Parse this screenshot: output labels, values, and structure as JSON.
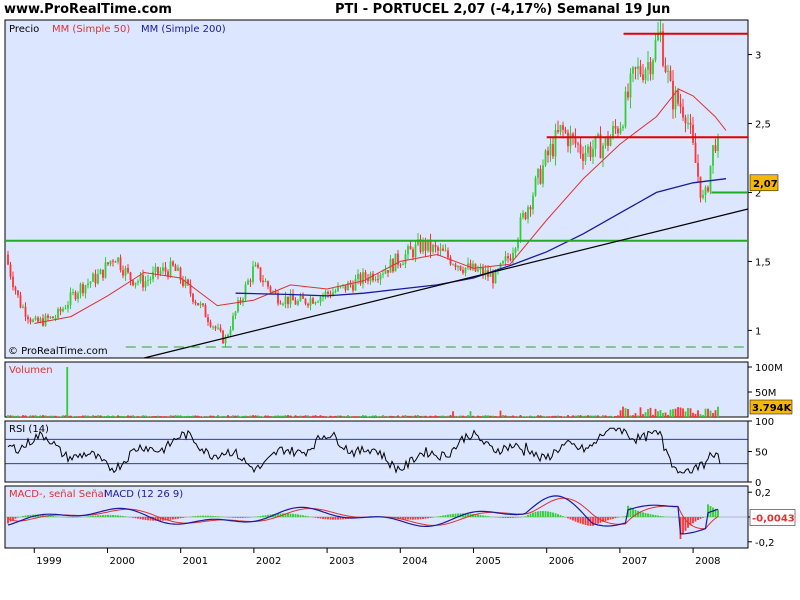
{
  "header": {
    "site": "www.ProRealTime.com",
    "title": "PTI - PORTUCEL   2,07 (-4,17%)   Semanal  19 Jun"
  },
  "colors": {
    "panel_bg": "#dde6ff",
    "candle_up": "#33cc33",
    "candle_down": "#ff3333",
    "ma50": "#e03030",
    "ma200": "#1a1aa0",
    "resistance": "#e00000",
    "support": "#22aa22",
    "trend": "#000000",
    "last_badge": "#f5b800"
  },
  "chart_data": [
    {
      "panel": "price",
      "type": "candlestick",
      "title": "Precio",
      "legend": [
        "Precio",
        "MM (Simple 50)",
        "MM (Simple 200)"
      ],
      "watermark": "© ProRealTime.com",
      "y_ticks": [
        "1",
        "1,5",
        "2",
        "2,5",
        "3"
      ],
      "ylim": [
        0.8,
        3.25
      ],
      "last_value_label": "2,07",
      "x_ticks": [
        "1999",
        "2000",
        "2001",
        "2002",
        "2003",
        "2004",
        "2005",
        "2006",
        "2007",
        "2008"
      ],
      "xlim": [
        1998.6,
        2008.75
      ],
      "series": [
        {
          "name": "Precio",
          "x": [
            1998.6,
            1998.8,
            1999.0,
            1999.3,
            1999.6,
            1999.9,
            2000.1,
            2000.3,
            2000.5,
            2000.7,
            2000.9,
            2001.1,
            2001.3,
            2001.6,
            2001.8,
            2002.0,
            2002.3,
            2002.6,
            2002.9,
            2003.2,
            2003.5,
            2003.8,
            2004.0,
            2004.3,
            2004.6,
            2004.9,
            2005.1,
            2005.3,
            2005.5,
            2005.7,
            2006.0,
            2006.2,
            2006.5,
            2006.8,
            2007.0,
            2007.2,
            2007.4,
            2007.55,
            2007.7,
            2007.9,
            2008.0,
            2008.15,
            2008.3,
            2008.45
          ],
          "values": [
            1.55,
            1.2,
            1.05,
            1.1,
            1.3,
            1.4,
            1.55,
            1.38,
            1.35,
            1.42,
            1.45,
            1.3,
            1.15,
            0.92,
            1.2,
            1.45,
            1.25,
            1.2,
            1.25,
            1.3,
            1.38,
            1.45,
            1.52,
            1.62,
            1.55,
            1.45,
            1.42,
            1.38,
            1.55,
            1.85,
            2.25,
            2.45,
            2.3,
            2.35,
            2.5,
            2.85,
            2.95,
            3.15,
            2.7,
            2.6,
            2.3,
            1.9,
            2.4,
            2.07
          ]
        },
        {
          "name": "MM (Simple 50)",
          "x": [
            1999.0,
            1999.5,
            2000.0,
            2000.5,
            2001.0,
            2001.5,
            2002.0,
            2002.5,
            2003.0,
            2003.5,
            2004.0,
            2004.5,
            2005.0,
            2005.5,
            2006.0,
            2006.5,
            2007.0,
            2007.5,
            2007.8,
            2008.0,
            2008.3,
            2008.45
          ],
          "values": [
            1.05,
            1.1,
            1.25,
            1.42,
            1.38,
            1.18,
            1.22,
            1.33,
            1.3,
            1.36,
            1.5,
            1.55,
            1.45,
            1.48,
            1.8,
            2.1,
            2.35,
            2.55,
            2.75,
            2.7,
            2.55,
            2.45
          ]
        },
        {
          "name": "MM (Simple 200)",
          "x": [
            2001.75,
            2002.5,
            2003.0,
            2003.5,
            2004.0,
            2004.5,
            2005.0,
            2005.5,
            2006.0,
            2006.5,
            2007.0,
            2007.5,
            2008.0,
            2008.45
          ],
          "values": [
            1.27,
            1.26,
            1.25,
            1.27,
            1.3,
            1.33,
            1.38,
            1.47,
            1.57,
            1.7,
            1.85,
            2.0,
            2.07,
            2.1
          ]
        }
      ],
      "annotations": [
        {
          "type": "resistance",
          "value": 3.15,
          "x": [
            2007.05,
            2008.75
          ]
        },
        {
          "type": "resistance",
          "value": 2.4,
          "x": [
            2006.0,
            2008.75
          ]
        },
        {
          "type": "support",
          "value": 1.65,
          "x": [
            1998.6,
            2008.75
          ]
        },
        {
          "type": "support",
          "value": 2.0,
          "x": [
            2008.25,
            2008.75
          ]
        },
        {
          "type": "trendline",
          "x": [
            2000.5,
            2008.75
          ],
          "values": [
            0.8,
            1.88
          ]
        },
        {
          "type": "dashed-support",
          "value": 0.88,
          "x": [
            2000.25,
            2008.75
          ]
        }
      ]
    },
    {
      "panel": "volume",
      "type": "bar",
      "title": "Volumen",
      "y_ticks": [
        "100M",
        "50M"
      ],
      "last_value_label": "3.794K",
      "ylim": [
        0,
        110
      ]
    },
    {
      "panel": "rsi",
      "type": "line",
      "title": "RSI (14)",
      "y_ticks": [
        "100",
        "50",
        "0"
      ],
      "ylim": [
        0,
        100
      ],
      "levels": [
        70,
        30
      ]
    },
    {
      "panel": "macd",
      "type": "line",
      "title": "MACD-, señal Señal",
      "legend2": "MACD (12 26 9)",
      "y_ticks": [
        "0,2",
        "0",
        "-0,2"
      ],
      "last_value_label": "-0,0043",
      "ylim": [
        -0.25,
        0.25
      ]
    }
  ]
}
